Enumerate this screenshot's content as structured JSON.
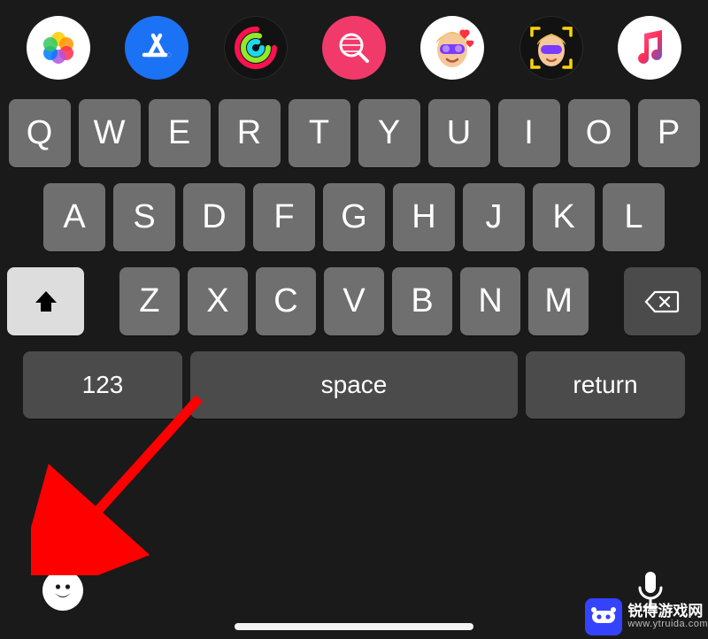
{
  "app_tray": {
    "icons": [
      "photos",
      "app-store",
      "activity",
      "search",
      "memoji-1",
      "memoji-2",
      "music"
    ]
  },
  "keyboard": {
    "row1": [
      "Q",
      "W",
      "E",
      "R",
      "T",
      "Y",
      "U",
      "I",
      "O",
      "P"
    ],
    "row2": [
      "A",
      "S",
      "D",
      "F",
      "G",
      "H",
      "J",
      "K",
      "L"
    ],
    "row3": [
      "Z",
      "X",
      "C",
      "V",
      "B",
      "N",
      "M"
    ],
    "shift_label": "",
    "delete_label": "",
    "fn": {
      "numbers": "123",
      "space": "space",
      "return": "return"
    }
  },
  "bottom": {
    "emoji_label": "",
    "mic_label": ""
  },
  "watermark": {
    "name": "锐得游戏网",
    "url": "www.ytruida.com"
  },
  "colors": {
    "key_bg": "#6f6f6f",
    "key_dark": "#4b4b4b",
    "shift_bg": "#dddddd",
    "accent_red": "#ff0000"
  }
}
